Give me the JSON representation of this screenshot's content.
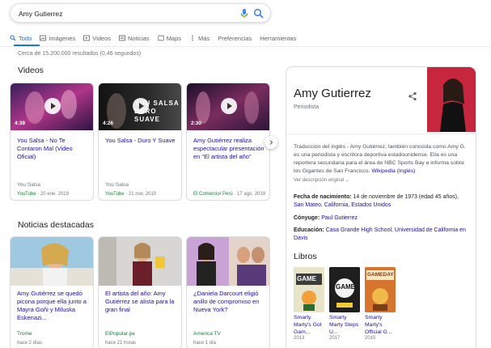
{
  "search": {
    "query": "Amy Gutierrez"
  },
  "tabs": [
    {
      "label": "Todo",
      "icon": "search-icon"
    },
    {
      "label": "Imágenes",
      "icon": "image-icon"
    },
    {
      "label": "Videos",
      "icon": "video-icon"
    },
    {
      "label": "Noticias",
      "icon": "news-icon"
    },
    {
      "label": "Maps",
      "icon": "map-icon"
    },
    {
      "label": "Más",
      "icon": "more-icon"
    },
    {
      "label": "Preferencias"
    },
    {
      "label": "Herramientas"
    }
  ],
  "results_count": "Cerca de 15.200.000 resultados (0,46 segundos)",
  "videos": {
    "title": "Videos",
    "items": [
      {
        "title": "You Salsa - No Te Contaron Mal (Video Oficial)",
        "duration": "4:39",
        "channel": "You Salsa",
        "source": "YouTube",
        "date": "· 20 ene. 2019"
      },
      {
        "title": "You Salsa - Duro Y Suave",
        "duration": "4:26",
        "overlay": "YOU SALSA DURO SUAVE",
        "channel": "You Salsa",
        "source": "YouTube",
        "date": "· 21 nov. 2010"
      },
      {
        "title": "Amy Gutiérrez realiza espectacular presentación en \"El artista del año\"",
        "duration": "2:30",
        "channel": "",
        "source": "El Comercio/ Perú",
        "date": "· 17 ago. 2019"
      }
    ]
  },
  "news": {
    "title": "Noticias destacadas",
    "items": [
      {
        "title": "Amy Gutiérrez se quedó picona porque ella junto a Mayra Goñi y Miluska Eskenazi...",
        "source": "Trome",
        "ago": "hace 2 días"
      },
      {
        "title": "El artista del año: Amy Gutiérrez se alista para la gran final",
        "source": "ElPopular.pe",
        "ago": "hace 21 horas"
      },
      {
        "title": "¿Daniela Darcourt eligió anillo de compromiso en Nueva York?",
        "source": "America TV",
        "ago": "hace 1 día"
      }
    ]
  },
  "panel": {
    "name": "Amy Gutierrez",
    "subtitle": "Periodista",
    "desc_pre": "Traducción del inglés - Amy Gutiérrez, también conocida como Amy G. es una periodista y escritora deportiva estadounidense. Ella es una reportera secundaria para el área de NBC Sports Bay e informa sobre los Gigantes de San Francisco.",
    "desc_link": "Wikipedia (Inglés)",
    "more": "Ver descripción original",
    "birth_label": "Fecha de nacimiento:",
    "birth_value": "14 de noviembre de 1973 (edad 45 años),",
    "birth_place": "San Mateo, California, Estados Unidos",
    "spouse_label": "Cónyuge:",
    "spouse_value": "Paul Gutierrez",
    "edu_label": "Educación:",
    "edu_value": "Casa Grande High School, Universidad de California en Davis",
    "books_title": "Libros",
    "books": [
      {
        "title": "Smarty Marty's Got Gam...",
        "year": "2013",
        "cover_text": "GAME"
      },
      {
        "title": "Smarty Marty Steps U...",
        "year": "2017",
        "cover_text": "GAME"
      },
      {
        "title": "Smarty Marty's Official G...",
        "year": "2015",
        "cover_text": "GAMEDAY"
      }
    ]
  },
  "colors": {
    "link": "#1a0dab",
    "source": "#188038",
    "accent": "#1a73e8"
  }
}
